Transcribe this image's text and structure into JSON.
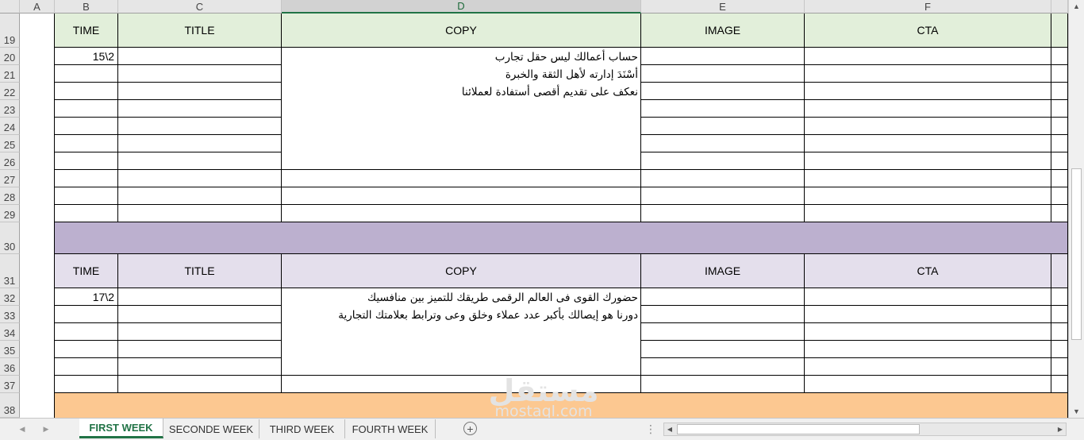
{
  "columns": [
    {
      "letter": "A"
    },
    {
      "letter": "B"
    },
    {
      "letter": "C"
    },
    {
      "letter": "D"
    },
    {
      "letter": "E"
    },
    {
      "letter": "F"
    }
  ],
  "rows": [
    "19",
    "20",
    "21",
    "22",
    "23",
    "24",
    "25",
    "26",
    "27",
    "28",
    "29",
    "30",
    "31",
    "32",
    "33",
    "34",
    "35",
    "36",
    "37",
    "38"
  ],
  "block1": {
    "headers": [
      "TIME",
      "TITLE",
      "COPY",
      "IMAGE",
      "CTA"
    ],
    "time": "15\\2",
    "copy_lines": [
      "حساب أعمالك ليس حقل تجارب",
      "أسْنَدَ إدارته لأهل الثقة والخبرة",
      "نعكف على تقديم أقصى أستفادة لعملائنا"
    ]
  },
  "block2": {
    "headers": [
      "TIME",
      "TITLE",
      "COPY",
      "IMAGE",
      "CTA"
    ],
    "time": "17\\2",
    "copy_lines": [
      "حضورك القوى فى العالم الرقمى طريقك للتميز بين منافسيك",
      "دورنا هو إيصالك بأكبر عدد عملاء وخلق وعى وترابط بعلامتك التجارية"
    ]
  },
  "colors": {
    "block1_header": "#e2efda",
    "separator": "#bcb0cf",
    "block2_header": "#e4dfec",
    "next_block": "#fcc891",
    "accent": "#217346"
  },
  "tabs": [
    {
      "label": "FIRST WEEK",
      "active": true
    },
    {
      "label": "SECONDE WEEK",
      "active": false
    },
    {
      "label": "THIRD WEEK",
      "active": false
    },
    {
      "label": "FOURTH WEEK",
      "active": false
    }
  ],
  "watermark": {
    "brand": "مستقل",
    "url": "mostaql.com"
  }
}
